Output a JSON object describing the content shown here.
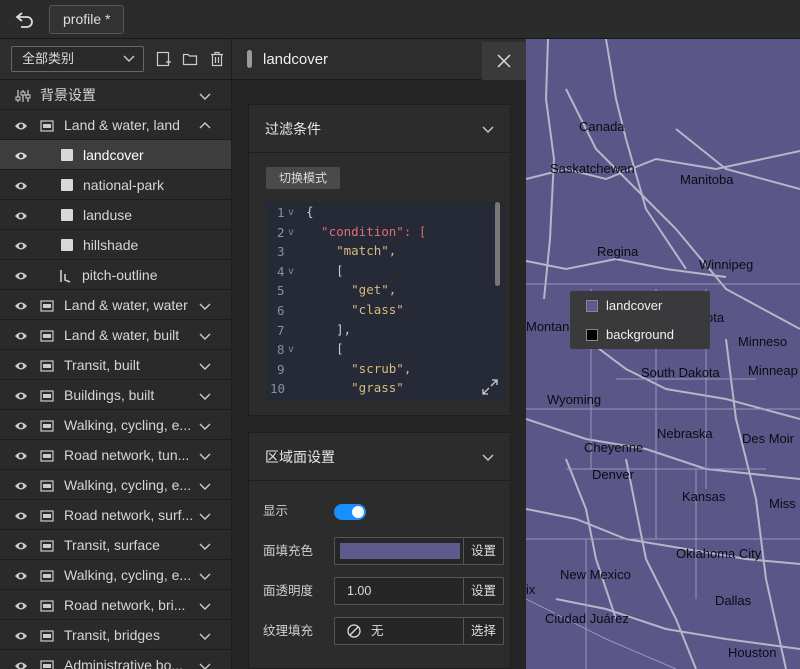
{
  "toolbar": {
    "profile_tab": "profile *"
  },
  "sidebar": {
    "category_select": "全部类别",
    "items": [
      {
        "label": "背景设置",
        "type": "group",
        "expanded": false
      },
      {
        "label": "Land & water, land",
        "type": "group",
        "expanded": true
      },
      {
        "label": "landcover",
        "type": "layer",
        "selected": true
      },
      {
        "label": "national-park",
        "type": "layer"
      },
      {
        "label": "landuse",
        "type": "layer"
      },
      {
        "label": "hillshade",
        "type": "layer"
      },
      {
        "label": "pitch-outline",
        "type": "layer"
      },
      {
        "label": "Land & water, water",
        "type": "group"
      },
      {
        "label": "Land & water, built",
        "type": "group"
      },
      {
        "label": "Transit, built",
        "type": "group"
      },
      {
        "label": "Buildings, built",
        "type": "group"
      },
      {
        "label": "Walking, cycling, e...",
        "type": "group"
      },
      {
        "label": "Road network, tun...",
        "type": "group"
      },
      {
        "label": "Walking, cycling, e...",
        "type": "group"
      },
      {
        "label": "Road network, surf...",
        "type": "group"
      },
      {
        "label": "Transit, surface",
        "type": "group"
      },
      {
        "label": "Walking, cycling, e...",
        "type": "group"
      },
      {
        "label": "Road network, bri...",
        "type": "group"
      },
      {
        "label": "Transit, bridges",
        "type": "group"
      },
      {
        "label": "Administrative bo...",
        "type": "group"
      }
    ]
  },
  "panel": {
    "title": "landcover",
    "filter": {
      "title": "过滤条件",
      "mode_button": "切换模式",
      "code_lines": [
        "{",
        "  \"condition\": [",
        "    \"match\",",
        "    [",
        "      \"get\",",
        "      \"class\"",
        "    ],",
        "    [",
        "      \"scrub\",",
        "      \"grass\""
      ]
    },
    "area": {
      "title": "区域面设置",
      "show_label": "显示",
      "fill_label": "面填充色",
      "fill_color": "#5e5a8c",
      "fill_button": "设置",
      "opacity_label": "面透明度",
      "opacity_value": "1.00",
      "opacity_button": "设置",
      "pattern_label": "纹理填充",
      "pattern_value": "无",
      "pattern_button": "选择"
    }
  },
  "map": {
    "fill_color": "#5a5687",
    "labels": [
      "Canada",
      "Saskatchewan",
      "Manitoba",
      "Regina",
      "Winnipeg",
      "Montan",
      "ota",
      "Minneso",
      "South Dakota",
      "Minneap",
      "Wyoming",
      "Nebraska",
      "Des Moir",
      "Cheyenne",
      "Denver",
      "Kansas",
      "Miss",
      "Oklahoma City",
      "New Mexico",
      "ix",
      "Dallas",
      "Ciudad Juárez",
      "Houston"
    ],
    "legend": [
      {
        "label": "landcover",
        "color": "#5e5a8c"
      },
      {
        "label": "background",
        "color": "#000000"
      }
    ]
  }
}
